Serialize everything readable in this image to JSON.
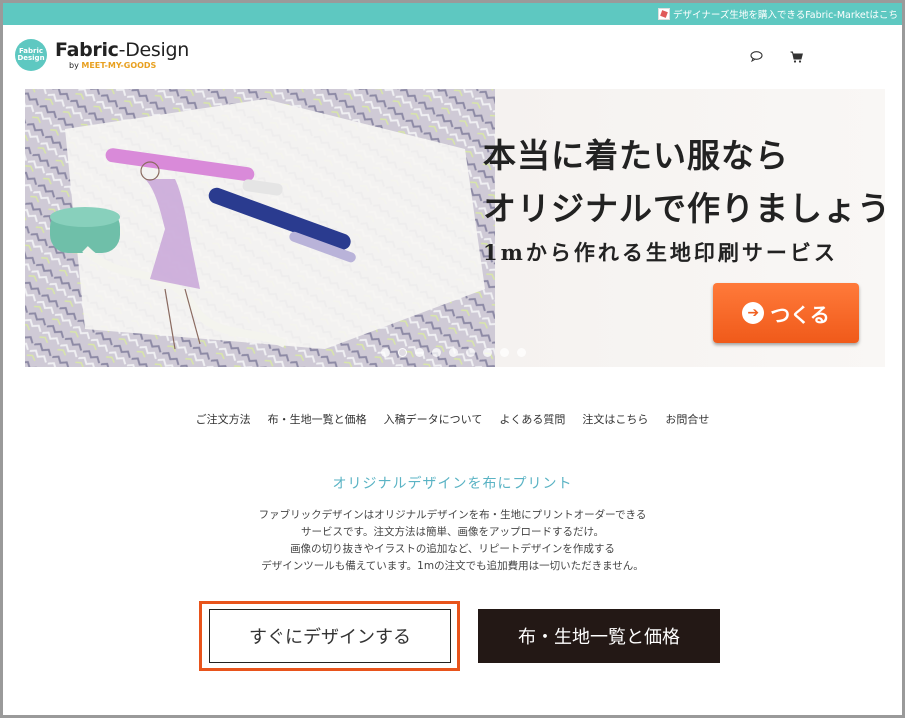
{
  "top_banner": {
    "link_text": "デザイナーズ生地を購入できるFabric-Marketはこち"
  },
  "logo": {
    "badge_text": "Fabric Design",
    "name_bold": "Fabric",
    "name_rest": "-Design",
    "sub_prefix": "by",
    "sub_brand": "MEET-MY-GOODS"
  },
  "header": {
    "chat_icon": "chat-bubble-icon",
    "cart_icon": "cart-icon"
  },
  "hero": {
    "line1": "本当に着たい服なら",
    "line2": "オリジナルで作りましょう",
    "line3": "1mから作れる生地印刷サービス",
    "cta_label": "つくる",
    "cta_arrow": "➔",
    "slide_count": 9,
    "active_slide": 1
  },
  "nav": {
    "items": [
      "ご注文方法",
      "布・生地一覧と価格",
      "入稿データについて",
      "よくある質問",
      "注文はこちら",
      "お問合せ"
    ]
  },
  "content": {
    "title": "オリジナルデザインを布にプリント",
    "desc_lines": [
      "ファブリックデザインはオリジナルデザインを布・生地にプリントオーダーできる",
      "サービスです。注文方法は簡単、画像をアップロードするだけ。",
      "画像の切り抜きやイラストの追加など、リピートデザインを作成する",
      "デザインツールも備えています。1mの注文でも追加費用は一切いただきません。"
    ],
    "design_button": "すぐにデザインする",
    "price_button": "布・生地一覧と価格"
  },
  "colors": {
    "teal": "#5ec8c1",
    "cta_orange": "#f05a1a",
    "highlight": "#e8541c",
    "dark_button": "#231815",
    "title_blue": "#5ab3c4"
  }
}
